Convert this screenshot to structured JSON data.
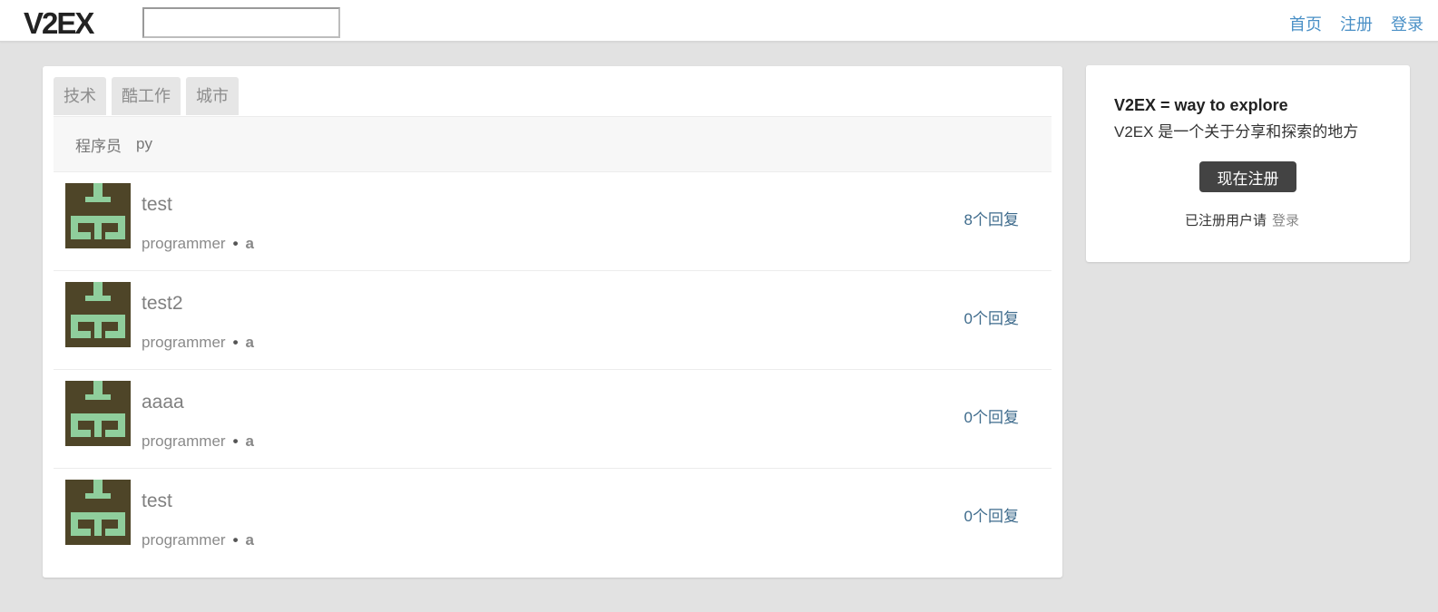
{
  "header": {
    "logo": "V2EX",
    "search": {
      "value": "",
      "placeholder": ""
    },
    "nav": [
      {
        "label": "首页"
      },
      {
        "label": "注册"
      },
      {
        "label": "登录"
      }
    ]
  },
  "tabs": [
    {
      "label": "技术"
    },
    {
      "label": "酷工作"
    },
    {
      "label": "城市"
    }
  ],
  "subnav": [
    {
      "label": "程序员"
    },
    {
      "label": "py"
    }
  ],
  "topics": [
    {
      "title": "test",
      "node": "programmer",
      "author": "a",
      "replies": "8个回复"
    },
    {
      "title": "test2",
      "node": "programmer",
      "author": "a",
      "replies": "0个回复"
    },
    {
      "title": "aaaa",
      "node": "programmer",
      "author": "a",
      "replies": "0个回复"
    },
    {
      "title": "test",
      "node": "programmer",
      "author": "a",
      "replies": "0个回复"
    }
  ],
  "topic_separator": "•",
  "sidebar": {
    "title": "V2EX = way to explore",
    "description": "V2EX 是一个关于分享和探索的地方",
    "signup_button": "现在注册",
    "login_prompt": "已注册用户请",
    "login_link": "登录"
  },
  "colors": {
    "link_blue": "#4a90c6",
    "avatar_bg": "#4e4528",
    "avatar_fg": "#8fce9c",
    "button_dark": "#434343",
    "page_bg": "#e2e2e2"
  }
}
